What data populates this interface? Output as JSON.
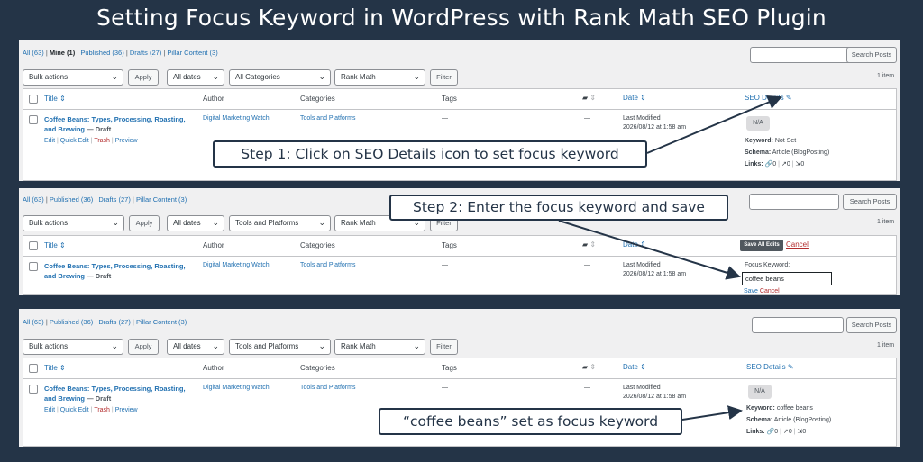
{
  "title": "Setting Focus Keyword in WordPress with Rank Math SEO Plugin",
  "colors": {
    "background": "#243447",
    "link": "#2271b1",
    "trash": "#b32d2e"
  },
  "panel1": {
    "filters": {
      "all": "All (63)",
      "mine": "Mine (1)",
      "published": "Published (36)",
      "drafts": "Drafts (27)",
      "pillar": "Pillar Content (3)"
    },
    "search_button": "Search Posts",
    "bulk": "Bulk actions",
    "apply": "Apply",
    "dates": "All dates",
    "category": "All Categories",
    "seo_filter": "Rank Math",
    "filter": "Filter",
    "count": "1 item",
    "headers": {
      "title": "Title",
      "author": "Author",
      "categories": "Categories",
      "tags": "Tags",
      "date": "Date",
      "seo": "SEO Details"
    },
    "post": {
      "title_line1": "Coffee Beans: Types, Processing, Roasting,",
      "title_line2": "and Brewing",
      "state": "— Draft",
      "author": "Digital Marketing Watch",
      "category": "Tools and Platforms",
      "tags": "—",
      "comments": "—",
      "date_label": "Last Modified",
      "date_value": "2026/08/12 at 1:58 am"
    },
    "row_actions": {
      "edit": "Edit",
      "quick_edit": "Quick Edit",
      "trash": "Trash",
      "preview": "Preview"
    },
    "seo": {
      "score": "N/A",
      "keyword_label": "Keyword:",
      "keyword_value": "Not Set",
      "schema_label": "Schema:",
      "schema_value": "Article (BlogPosting)",
      "links_label": "Links:",
      "internal": "0",
      "external": "0",
      "incoming": "0"
    },
    "callout": "Step 1: Click on SEO Details icon to set focus keyword"
  },
  "panel2": {
    "filters": {
      "all": "All (63)",
      "published": "Published (36)",
      "drafts": "Drafts (27)",
      "pillar": "Pillar Content (3)"
    },
    "search_button": "Search Posts",
    "bulk": "Bulk actions",
    "apply": "Apply",
    "dates": "All dates",
    "category": "Tools and Platforms",
    "seo_filter": "Rank Math",
    "filter": "Filter",
    "count": "1 item",
    "headers": {
      "title": "Title",
      "author": "Author",
      "categories": "Categories",
      "tags": "Tags",
      "date": "Date"
    },
    "save_all": "Save All Edits",
    "cancel": "Cancel",
    "post": {
      "title_line1": "Coffee Beans: Types, Processing, Roasting,",
      "title_line2": "and Brewing",
      "state": "— Draft",
      "author": "Digital Marketing Watch",
      "category": "Tools and Platforms",
      "tags": "—",
      "comments": "—",
      "date_label": "Last Modified",
      "date_value": "2026/08/12 at 1:58 am"
    },
    "focus_label": "Focus Keyword:",
    "focus_value": "coffee beans",
    "save": "Save",
    "cancel2": "Cancel",
    "callout": "Step 2: Enter the focus keyword and save"
  },
  "panel3": {
    "filters": {
      "all": "All (63)",
      "published": "Published (36)",
      "drafts": "Drafts (27)",
      "pillar": "Pillar Content (3)"
    },
    "search_button": "Search Posts",
    "bulk": "Bulk actions",
    "apply": "Apply",
    "dates": "All dates",
    "category": "Tools and Platforms",
    "seo_filter": "Rank Math",
    "filter": "Filter",
    "count": "1 item",
    "headers": {
      "title": "Title",
      "author": "Author",
      "categories": "Categories",
      "tags": "Tags",
      "date": "Date",
      "seo": "SEO Details"
    },
    "post": {
      "title_line1": "Coffee Beans: Types, Processing, Roasting,",
      "title_line2": "and Brewing",
      "state": "— Draft",
      "author": "Digital Marketing Watch",
      "category": "Tools and Platforms",
      "tags": "—",
      "comments": "—",
      "date_label": "Last Modified",
      "date_value": "2026/08/12 at 1:58 am"
    },
    "row_actions": {
      "edit": "Edit",
      "quick_edit": "Quick Edit",
      "trash": "Trash",
      "preview": "Preview"
    },
    "seo": {
      "score": "N/A",
      "keyword_label": "Keyword:",
      "keyword_value": "coffee beans",
      "schema_label": "Schema:",
      "schema_value": "Article (BlogPosting)",
      "links_label": "Links:",
      "internal": "0",
      "external": "0",
      "incoming": "0"
    },
    "callout": "“coffee beans” set as focus keyword"
  }
}
